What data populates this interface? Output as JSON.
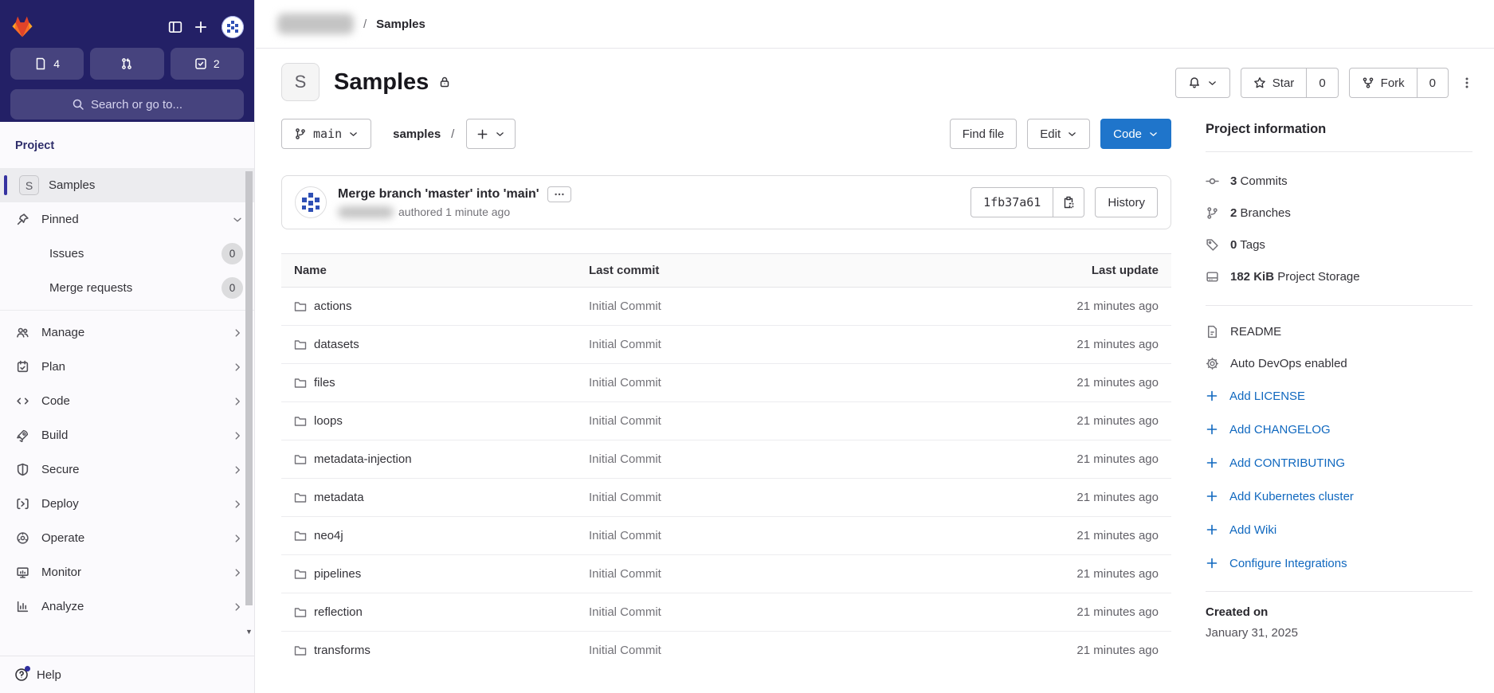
{
  "colors": {
    "accent": "#1f75cb",
    "link": "#1068bf",
    "sidebar_dark": "#232066",
    "logo_red": "#e24329",
    "logo_orange": "#fc6d26",
    "logo_yellow": "#fca326"
  },
  "topbar": {
    "breadcrumb_separator": "/",
    "breadcrumb_current": "Samples"
  },
  "sidebar": {
    "counts": {
      "issues": "4",
      "todos": "2"
    },
    "search_placeholder": "Search or go to...",
    "section_label": "Project",
    "project_item": {
      "avatar_letter": "S",
      "label": "Samples"
    },
    "pinned": {
      "label": "Pinned"
    },
    "pinned_items": [
      {
        "label": "Issues",
        "badge": "0"
      },
      {
        "label": "Merge requests",
        "badge": "0"
      }
    ],
    "nav_items": [
      {
        "label": "Manage",
        "icon": "people-icon"
      },
      {
        "label": "Plan",
        "icon": "calendar-icon"
      },
      {
        "label": "Code",
        "icon": "code-icon"
      },
      {
        "label": "Build",
        "icon": "rocket-icon"
      },
      {
        "label": "Secure",
        "icon": "shield-icon"
      },
      {
        "label": "Deploy",
        "icon": "deploy-icon"
      },
      {
        "label": "Operate",
        "icon": "operate-icon"
      },
      {
        "label": "Monitor",
        "icon": "monitor-icon"
      },
      {
        "label": "Analyze",
        "icon": "chart-icon"
      }
    ],
    "help_label": "Help"
  },
  "header": {
    "avatar_letter": "S",
    "title": "Samples",
    "star_label": "Star",
    "star_count": "0",
    "fork_label": "Fork",
    "fork_count": "0"
  },
  "toolbar": {
    "branch": "main",
    "path": "samples",
    "path_separator": "/",
    "find_file_label": "Find file",
    "edit_label": "Edit",
    "code_label": "Code"
  },
  "commit": {
    "title": "Merge branch 'master' into 'main'",
    "meta": "authored 1 minute ago",
    "sha": "1fb37a61",
    "history_label": "History"
  },
  "table": {
    "headers": [
      "Name",
      "Last commit",
      "Last update"
    ],
    "rows": [
      {
        "name": "actions",
        "commit": "Initial Commit",
        "updated": "21 minutes ago"
      },
      {
        "name": "datasets",
        "commit": "Initial Commit",
        "updated": "21 minutes ago"
      },
      {
        "name": "files",
        "commit": "Initial Commit",
        "updated": "21 minutes ago"
      },
      {
        "name": "loops",
        "commit": "Initial Commit",
        "updated": "21 minutes ago"
      },
      {
        "name": "metadata-injection",
        "commit": "Initial Commit",
        "updated": "21 minutes ago"
      },
      {
        "name": "metadata",
        "commit": "Initial Commit",
        "updated": "21 minutes ago"
      },
      {
        "name": "neo4j",
        "commit": "Initial Commit",
        "updated": "21 minutes ago"
      },
      {
        "name": "pipelines",
        "commit": "Initial Commit",
        "updated": "21 minutes ago"
      },
      {
        "name": "reflection",
        "commit": "Initial Commit",
        "updated": "21 minutes ago"
      },
      {
        "name": "transforms",
        "commit": "Initial Commit",
        "updated": "21 minutes ago"
      }
    ]
  },
  "info": {
    "title": "Project information",
    "stats": [
      {
        "value": "3",
        "label": "Commits",
        "icon": "commit-icon"
      },
      {
        "value": "2",
        "label": "Branches",
        "icon": "branch-icon"
      },
      {
        "value": "0",
        "label": "Tags",
        "icon": "tag-icon"
      },
      {
        "value": "182 KiB",
        "label": "Project Storage",
        "icon": "disk-icon"
      }
    ],
    "features": [
      {
        "label": "README",
        "icon": "document-icon"
      },
      {
        "label": "Auto DevOps enabled",
        "icon": "gear-icon"
      }
    ],
    "links": [
      "Add LICENSE",
      "Add CHANGELOG",
      "Add CONTRIBUTING",
      "Add Kubernetes cluster",
      "Add Wiki",
      "Configure Integrations"
    ],
    "created_label": "Created on",
    "created_date": "January 31, 2025"
  }
}
